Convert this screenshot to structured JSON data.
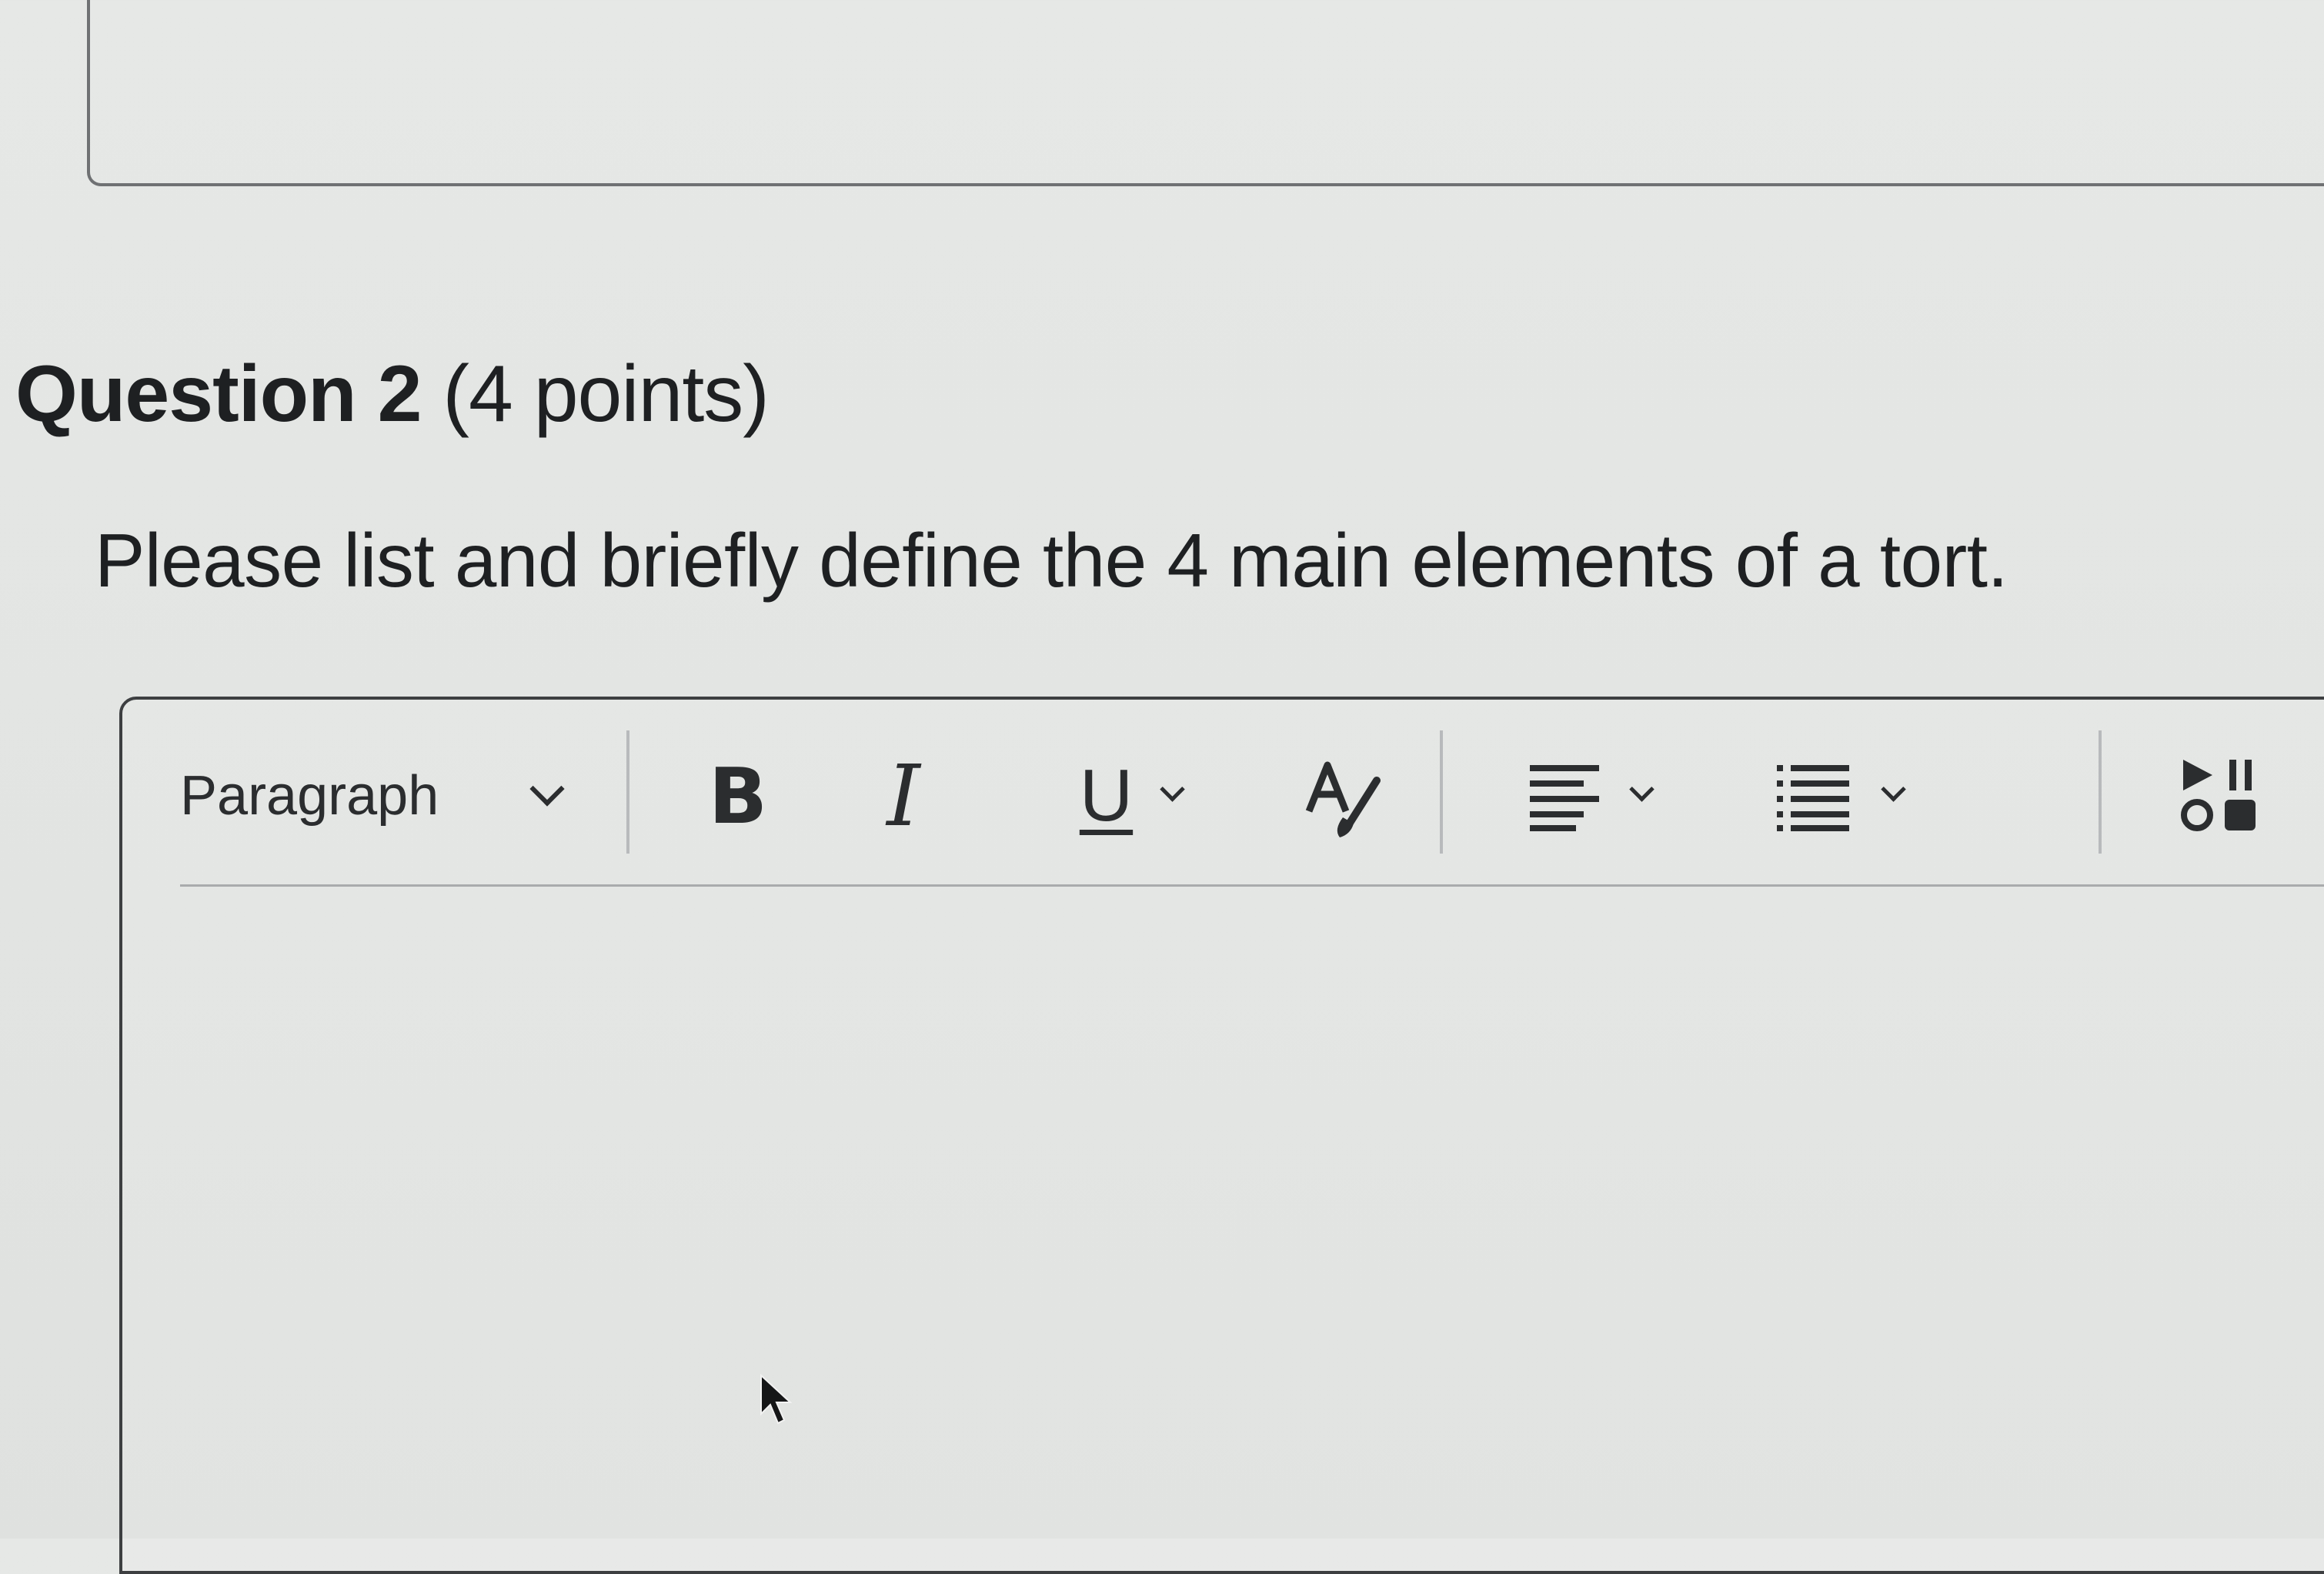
{
  "question": {
    "label": "Question 2",
    "points": "(4 points)",
    "prompt": "Please list and briefly define the 4 main elements of a tort."
  },
  "toolbar": {
    "format_label": "Paragraph",
    "bold_label": "B",
    "italic_label": "I",
    "underline_label": "U",
    "icons": [
      "chevron-down-icon",
      "text-color-icon",
      "align-left-icon",
      "list-icon",
      "media-icon",
      "link-icon"
    ]
  },
  "editor": {
    "value": ""
  },
  "colors": {
    "text": "#1e2022",
    "border": "#3d3f41"
  }
}
